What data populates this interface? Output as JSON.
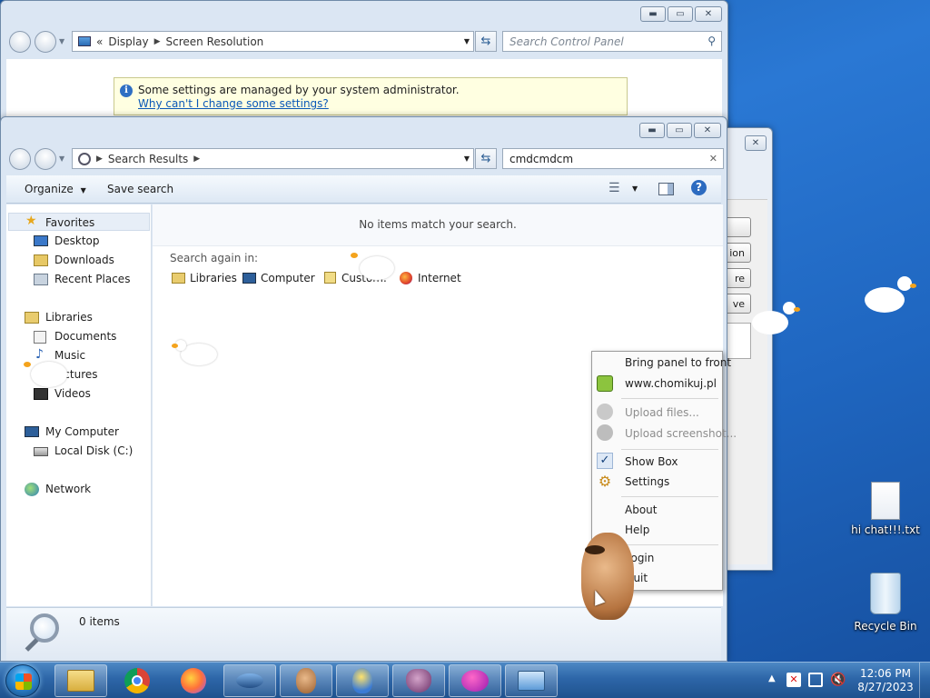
{
  "back_window": {
    "breadcrumb": [
      "Display",
      "Screen Resolution"
    ],
    "breadcrumb_prefix": "«",
    "search_placeholder": "Search Control Panel",
    "info_message": "Some settings are managed by your system administrator.",
    "info_link": "Why can't I change some settings?"
  },
  "explorer": {
    "breadcrumb": [
      "Search Results"
    ],
    "search_value": "cmdcmdcm",
    "toolbar": {
      "organize": "Organize",
      "save_search": "Save search"
    },
    "empty_message": "No items match your search.",
    "search_again_label": "Search again in:",
    "search_again_items": [
      "Libraries",
      "Computer",
      "Custom...",
      "Internet"
    ],
    "nav": {
      "favorites": "Favorites",
      "favorites_items": [
        "Desktop",
        "Downloads",
        "Recent Places"
      ],
      "libraries": "Libraries",
      "libraries_items": [
        "Documents",
        "Music",
        "Pictures",
        "Videos"
      ],
      "computer": "My Computer",
      "computer_items": [
        "Local Disk (C:)"
      ],
      "network": "Network"
    },
    "status": "0 items"
  },
  "side_window_buttons": [
    "",
    "ion",
    "re",
    "ve"
  ],
  "context_menu": {
    "items": [
      {
        "label": "Bring panel to front",
        "disabled": false
      },
      {
        "label": "www.chomikuj.pl",
        "disabled": false
      },
      {
        "label": "Upload files...",
        "disabled": true
      },
      {
        "label": "Upload screenshot...",
        "disabled": true
      },
      {
        "label": "Show Box",
        "disabled": false,
        "checked": true
      },
      {
        "label": "Settings",
        "disabled": false
      },
      {
        "label": "About",
        "disabled": false
      },
      {
        "label": "Help",
        "disabled": false
      },
      {
        "label": "Login",
        "disabled": false
      },
      {
        "label": "Quit",
        "disabled": false
      }
    ]
  },
  "desktop_icons": [
    {
      "label": "hi chat!!!.txt",
      "icon": "text-file-icon"
    },
    {
      "label": "Recycle Bin",
      "icon": "recycle-bin-icon"
    }
  ],
  "taskbar": {
    "clock_time": "12:06 PM",
    "clock_date": "8/27/2023",
    "pinned": [
      "explorer",
      "chrome",
      "firefox",
      "ufo",
      "hamster",
      "bird",
      "bag",
      "hat",
      "control-panel"
    ]
  },
  "colors": {
    "desktop": "#1f66c0",
    "info_bar": "#ffffe1",
    "taskbar": "#2d66a8"
  }
}
